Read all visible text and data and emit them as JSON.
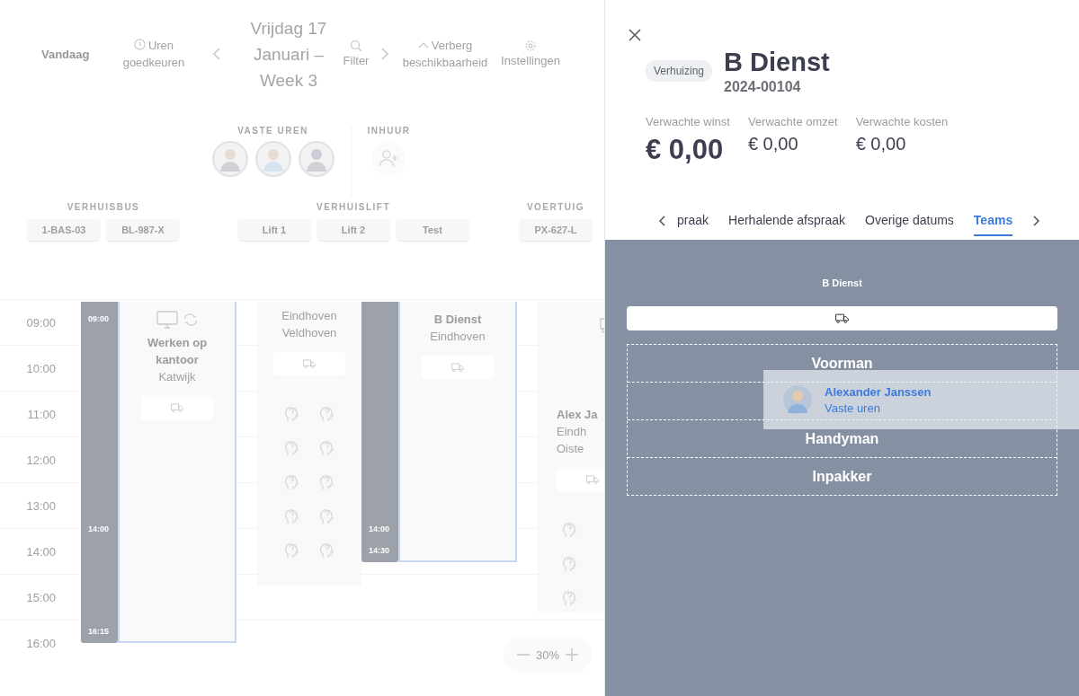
{
  "toolbar": {
    "today": "Vandaag",
    "approve": "Uren goedkeuren",
    "period": "Vrijdag 17 Januari – Week 3",
    "filter": "Filter",
    "hide": "Verberg beschikbaarheid",
    "settings": "Instellingen"
  },
  "staff": {
    "fixed_title": "VASTE UREN",
    "hire_title": "INHUUR"
  },
  "resource_groups": [
    {
      "title": "VERHUISBUS",
      "items": [
        "1-BAS-03",
        "BL-987-X"
      ]
    },
    {
      "title": "VERHUISLIFT",
      "items": [
        "Lift 1",
        "Lift 2",
        "Test"
      ]
    },
    {
      "title": "VOERTUIG",
      "items": [
        "PX-627-L"
      ]
    }
  ],
  "calendar": {
    "hours": [
      "09:00",
      "10:00",
      "11:00",
      "12:00",
      "13:00",
      "14:00",
      "15:00",
      "16:00"
    ],
    "events": [
      {
        "kind": "shift",
        "highlighted": true,
        "marks": [
          "09:00",
          "14:00",
          "16:15"
        ],
        "icons": [
          {
            "kind": "monitor"
          },
          {
            "kind": "repeat"
          }
        ],
        "title": "Werken op kantoor",
        "lines": [
          "Katwijk"
        ]
      },
      {
        "kind": "open",
        "lines": [
          "Eindhoven",
          "Veldhoven"
        ],
        "slots": [
          {
            "kind": "unknown"
          },
          {
            "kind": "unknown"
          },
          {
            "kind": "unknown"
          },
          {
            "kind": "unknown"
          },
          {
            "kind": "unknown"
          },
          {
            "kind": "unknown"
          },
          {
            "kind": "unknown"
          },
          {
            "kind": "unknown"
          },
          {
            "kind": "unknown"
          },
          {
            "kind": "unknown"
          }
        ]
      },
      {
        "kind": "shift",
        "highlighted": true,
        "marks": [
          "14:00",
          "14:30"
        ],
        "title": "B Dienst",
        "lines": [
          "Eindhoven"
        ]
      },
      {
        "kind": "open",
        "icons": [
          {
            "kind": "truck"
          }
        ],
        "title": "Alex Ja",
        "lines": [
          "Eindh",
          "Oiste"
        ],
        "slots": [
          {
            "kind": "unknown"
          },
          {
            "kind": "unknown"
          },
          {
            "kind": "unknown"
          }
        ]
      }
    ],
    "zoom": "30%"
  },
  "detail": {
    "badge": "Verhuizing",
    "title": "B Dienst",
    "number": "2024-00104",
    "stats": [
      {
        "label": "Verwachte winst",
        "value": "€ 0,00"
      },
      {
        "label": "Verwachte omzet",
        "value": "€ 0,00"
      },
      {
        "label": "Verwachte kosten",
        "value": "€ 0,00"
      }
    ],
    "tabs": [
      {
        "label": "praak",
        "selected": false
      },
      {
        "label": "Herhalende afspraak",
        "selected": false
      },
      {
        "label": "Overige datums",
        "selected": false
      },
      {
        "label": "Teams",
        "selected": true
      }
    ]
  },
  "teams": {
    "title": "B Dienst",
    "roles": [
      {
        "kind": "role",
        "label": "Voorman"
      },
      {
        "kind": "slot"
      },
      {
        "kind": "role",
        "label": "Handyman"
      },
      {
        "kind": "role",
        "label": "Inpakker"
      }
    ],
    "dragging": {
      "name": "Alexander Janssen",
      "type": "Vaste uren"
    }
  }
}
